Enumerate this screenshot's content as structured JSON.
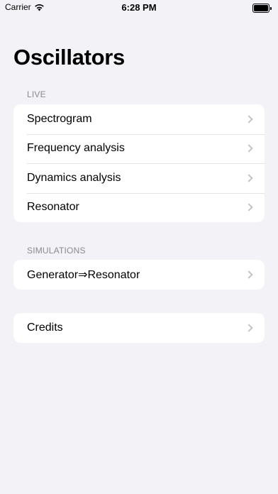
{
  "status_bar": {
    "carrier": "Carrier",
    "time": "6:28 PM",
    "icons": [
      "wifi-icon",
      "battery-icon"
    ]
  },
  "title": "Oscillators",
  "sections": [
    {
      "header": "LIVE",
      "items": [
        {
          "label": "Spectrogram"
        },
        {
          "label": "Frequency analysis"
        },
        {
          "label": "Dynamics analysis"
        },
        {
          "label": "Resonator"
        }
      ]
    },
    {
      "header": "SIMULATIONS",
      "items": [
        {
          "label": "Generator⇒Resonator"
        }
      ]
    },
    {
      "header": "",
      "items": [
        {
          "label": "Credits"
        }
      ]
    }
  ],
  "colors": {
    "background": "#f2f2f7",
    "cell": "#ffffff",
    "header_text": "#8a8a8e",
    "chevron": "#c4c4c7"
  }
}
